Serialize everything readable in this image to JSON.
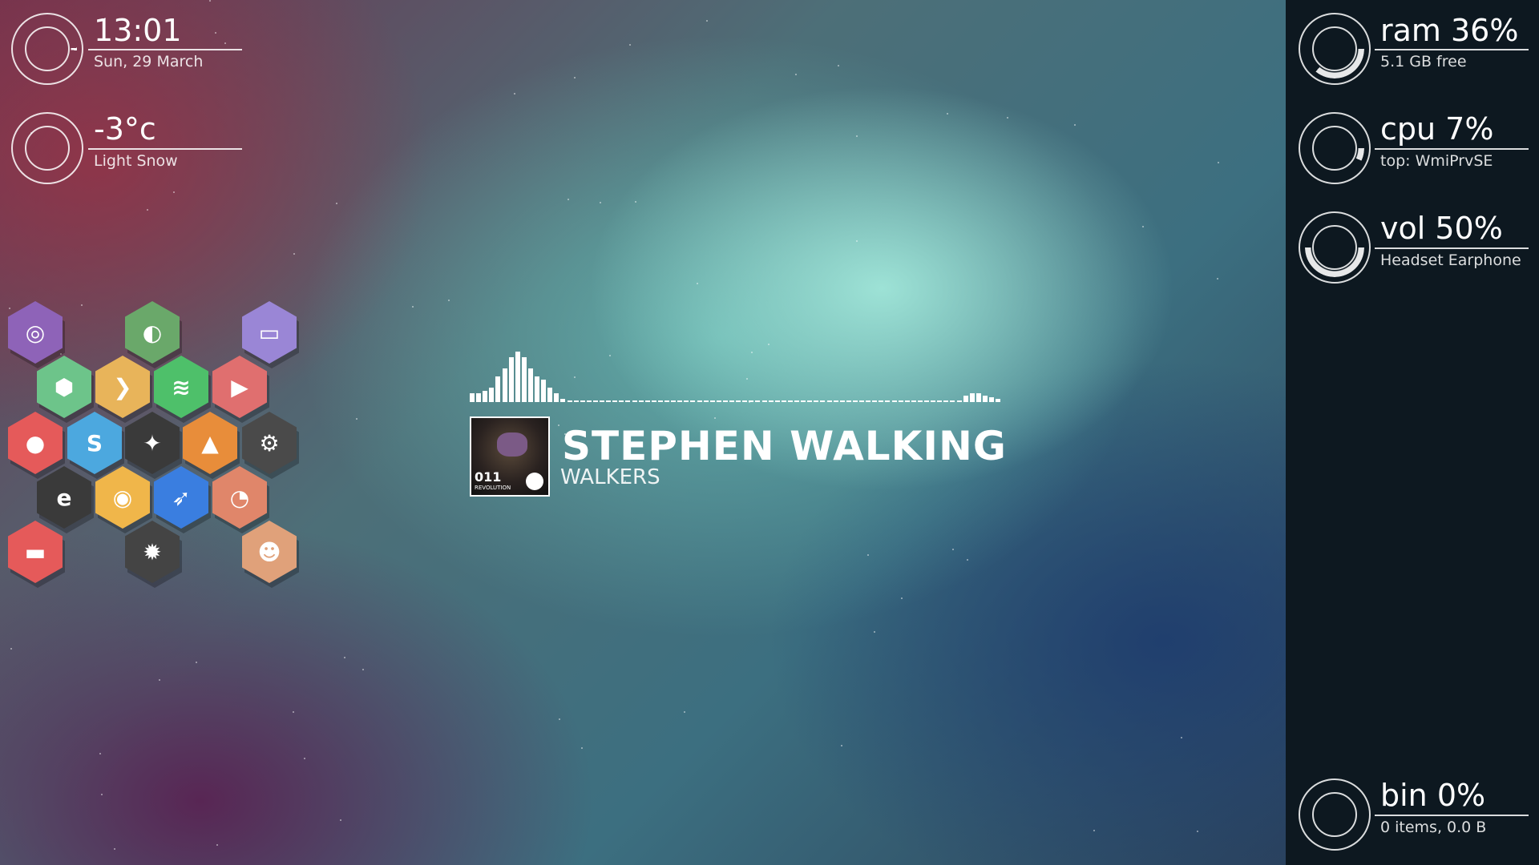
{
  "clock": {
    "time": "13:01",
    "date": "Sun, 29 March"
  },
  "weather": {
    "temp": "-3°c",
    "condition": "Light Snow"
  },
  "ram": {
    "label": "ram 36%",
    "detail": "5.1 GB free",
    "percent": 36
  },
  "cpu": {
    "label": "cpu 7%",
    "detail": "top: WmiPrvSE",
    "percent": 7
  },
  "vol": {
    "label": "vol 50%",
    "detail": "Headset Earphone",
    "percent": 50
  },
  "bin": {
    "label": "bin 0%",
    "detail": "0 items, 0.0 B",
    "percent": 0
  },
  "now_playing": {
    "title": "STEPHEN WALKING",
    "artist": "WALKERS",
    "album_number": "011",
    "album_label": "REVOLUTION"
  },
  "launcher": {
    "apps": [
      {
        "name": "bittorrent",
        "color": "#8e63b8",
        "glyph": "◎"
      },
      {
        "name": "nvidia",
        "color": "#6aa86a",
        "glyph": "◐"
      },
      {
        "name": "twitch",
        "color": "#9a86d6",
        "glyph": "▭"
      },
      {
        "name": "3d-box",
        "color": "#6dc48a",
        "glyph": "⬢"
      },
      {
        "name": "terminal",
        "color": "#e8b45a",
        "glyph": "❯"
      },
      {
        "name": "spotify",
        "color": "#4ec06a",
        "glyph": "≋"
      },
      {
        "name": "youtube",
        "color": "#e06f6f",
        "glyph": "▶"
      },
      {
        "name": "bag",
        "color": "#e55a5a",
        "glyph": "●"
      },
      {
        "name": "skype",
        "color": "#4ca8df",
        "glyph": "S"
      },
      {
        "name": "skyrim",
        "color": "#3a3a3a",
        "glyph": "✦"
      },
      {
        "name": "vlc",
        "color": "#e88d3a",
        "glyph": "▲"
      },
      {
        "name": "steam",
        "color": "#4a4a4a",
        "glyph": "⚙"
      },
      {
        "name": "origin",
        "color": "#3a3a3a",
        "glyph": "e"
      },
      {
        "name": "chrome",
        "color": "#f0b64a",
        "glyph": "◉"
      },
      {
        "name": "final-fantasy",
        "color": "#3a7ee0",
        "glyph": "➶"
      },
      {
        "name": "firefox",
        "color": "#e0866a",
        "glyph": "◔"
      },
      {
        "name": "couch",
        "color": "#e55a5a",
        "glyph": "▬"
      },
      {
        "name": "settings",
        "color": "#444444",
        "glyph": "✹"
      },
      {
        "name": "head",
        "color": "#e0a17a",
        "glyph": "☻"
      }
    ]
  },
  "visualizer": {
    "bars": [
      0.15,
      0.15,
      0.2,
      0.25,
      0.45,
      0.6,
      0.8,
      0.9,
      0.8,
      0.6,
      0.45,
      0.4,
      0.25,
      0.15,
      0.05,
      0.03,
      0.03,
      0.03,
      0.03,
      0.03,
      0.03,
      0.03,
      0.03,
      0.03,
      0.03,
      0.03,
      0.03,
      0.03,
      0.03,
      0.03,
      0.03,
      0.03,
      0.03,
      0.03,
      0.03,
      0.03,
      0.03,
      0.03,
      0.03,
      0.03,
      0.03,
      0.03,
      0.03,
      0.03,
      0.03,
      0.03,
      0.03,
      0.03,
      0.03,
      0.03,
      0.03,
      0.03,
      0.03,
      0.03,
      0.03,
      0.03,
      0.03,
      0.03,
      0.03,
      0.03,
      0.03,
      0.03,
      0.03,
      0.03,
      0.03,
      0.03,
      0.03,
      0.03,
      0.03,
      0.03,
      0.03,
      0.03,
      0.03,
      0.03,
      0.03,
      0.03,
      0.12,
      0.15,
      0.15,
      0.12,
      0.08,
      0.05
    ]
  }
}
